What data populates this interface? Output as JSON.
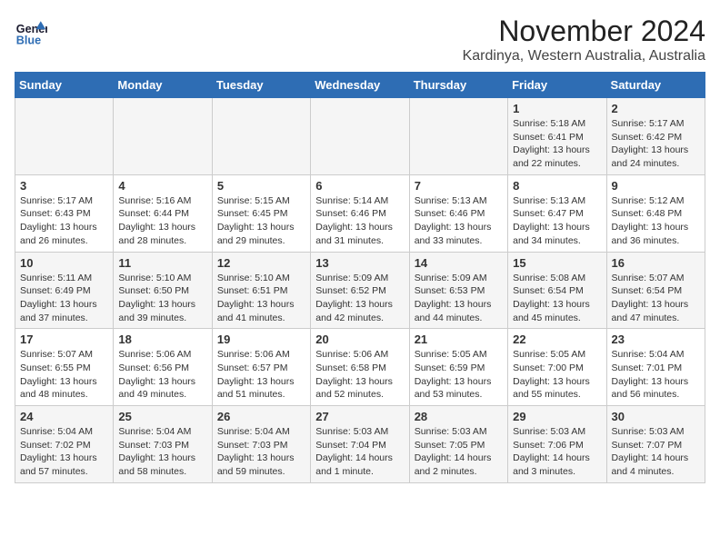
{
  "header": {
    "logo_line1": "General",
    "logo_line2": "Blue",
    "title": "November 2024",
    "subtitle": "Kardinya, Western Australia, Australia"
  },
  "weekdays": [
    "Sunday",
    "Monday",
    "Tuesday",
    "Wednesday",
    "Thursday",
    "Friday",
    "Saturday"
  ],
  "weeks": [
    [
      {
        "day": "",
        "detail": ""
      },
      {
        "day": "",
        "detail": ""
      },
      {
        "day": "",
        "detail": ""
      },
      {
        "day": "",
        "detail": ""
      },
      {
        "day": "",
        "detail": ""
      },
      {
        "day": "1",
        "detail": "Sunrise: 5:18 AM\nSunset: 6:41 PM\nDaylight: 13 hours\nand 22 minutes."
      },
      {
        "day": "2",
        "detail": "Sunrise: 5:17 AM\nSunset: 6:42 PM\nDaylight: 13 hours\nand 24 minutes."
      }
    ],
    [
      {
        "day": "3",
        "detail": "Sunrise: 5:17 AM\nSunset: 6:43 PM\nDaylight: 13 hours\nand 26 minutes."
      },
      {
        "day": "4",
        "detail": "Sunrise: 5:16 AM\nSunset: 6:44 PM\nDaylight: 13 hours\nand 28 minutes."
      },
      {
        "day": "5",
        "detail": "Sunrise: 5:15 AM\nSunset: 6:45 PM\nDaylight: 13 hours\nand 29 minutes."
      },
      {
        "day": "6",
        "detail": "Sunrise: 5:14 AM\nSunset: 6:46 PM\nDaylight: 13 hours\nand 31 minutes."
      },
      {
        "day": "7",
        "detail": "Sunrise: 5:13 AM\nSunset: 6:46 PM\nDaylight: 13 hours\nand 33 minutes."
      },
      {
        "day": "8",
        "detail": "Sunrise: 5:13 AM\nSunset: 6:47 PM\nDaylight: 13 hours\nand 34 minutes."
      },
      {
        "day": "9",
        "detail": "Sunrise: 5:12 AM\nSunset: 6:48 PM\nDaylight: 13 hours\nand 36 minutes."
      }
    ],
    [
      {
        "day": "10",
        "detail": "Sunrise: 5:11 AM\nSunset: 6:49 PM\nDaylight: 13 hours\nand 37 minutes."
      },
      {
        "day": "11",
        "detail": "Sunrise: 5:10 AM\nSunset: 6:50 PM\nDaylight: 13 hours\nand 39 minutes."
      },
      {
        "day": "12",
        "detail": "Sunrise: 5:10 AM\nSunset: 6:51 PM\nDaylight: 13 hours\nand 41 minutes."
      },
      {
        "day": "13",
        "detail": "Sunrise: 5:09 AM\nSunset: 6:52 PM\nDaylight: 13 hours\nand 42 minutes."
      },
      {
        "day": "14",
        "detail": "Sunrise: 5:09 AM\nSunset: 6:53 PM\nDaylight: 13 hours\nand 44 minutes."
      },
      {
        "day": "15",
        "detail": "Sunrise: 5:08 AM\nSunset: 6:54 PM\nDaylight: 13 hours\nand 45 minutes."
      },
      {
        "day": "16",
        "detail": "Sunrise: 5:07 AM\nSunset: 6:54 PM\nDaylight: 13 hours\nand 47 minutes."
      }
    ],
    [
      {
        "day": "17",
        "detail": "Sunrise: 5:07 AM\nSunset: 6:55 PM\nDaylight: 13 hours\nand 48 minutes."
      },
      {
        "day": "18",
        "detail": "Sunrise: 5:06 AM\nSunset: 6:56 PM\nDaylight: 13 hours\nand 49 minutes."
      },
      {
        "day": "19",
        "detail": "Sunrise: 5:06 AM\nSunset: 6:57 PM\nDaylight: 13 hours\nand 51 minutes."
      },
      {
        "day": "20",
        "detail": "Sunrise: 5:06 AM\nSunset: 6:58 PM\nDaylight: 13 hours\nand 52 minutes."
      },
      {
        "day": "21",
        "detail": "Sunrise: 5:05 AM\nSunset: 6:59 PM\nDaylight: 13 hours\nand 53 minutes."
      },
      {
        "day": "22",
        "detail": "Sunrise: 5:05 AM\nSunset: 7:00 PM\nDaylight: 13 hours\nand 55 minutes."
      },
      {
        "day": "23",
        "detail": "Sunrise: 5:04 AM\nSunset: 7:01 PM\nDaylight: 13 hours\nand 56 minutes."
      }
    ],
    [
      {
        "day": "24",
        "detail": "Sunrise: 5:04 AM\nSunset: 7:02 PM\nDaylight: 13 hours\nand 57 minutes."
      },
      {
        "day": "25",
        "detail": "Sunrise: 5:04 AM\nSunset: 7:03 PM\nDaylight: 13 hours\nand 58 minutes."
      },
      {
        "day": "26",
        "detail": "Sunrise: 5:04 AM\nSunset: 7:03 PM\nDaylight: 13 hours\nand 59 minutes."
      },
      {
        "day": "27",
        "detail": "Sunrise: 5:03 AM\nSunset: 7:04 PM\nDaylight: 14 hours\nand 1 minute."
      },
      {
        "day": "28",
        "detail": "Sunrise: 5:03 AM\nSunset: 7:05 PM\nDaylight: 14 hours\nand 2 minutes."
      },
      {
        "day": "29",
        "detail": "Sunrise: 5:03 AM\nSunset: 7:06 PM\nDaylight: 14 hours\nand 3 minutes."
      },
      {
        "day": "30",
        "detail": "Sunrise: 5:03 AM\nSunset: 7:07 PM\nDaylight: 14 hours\nand 4 minutes."
      }
    ]
  ]
}
